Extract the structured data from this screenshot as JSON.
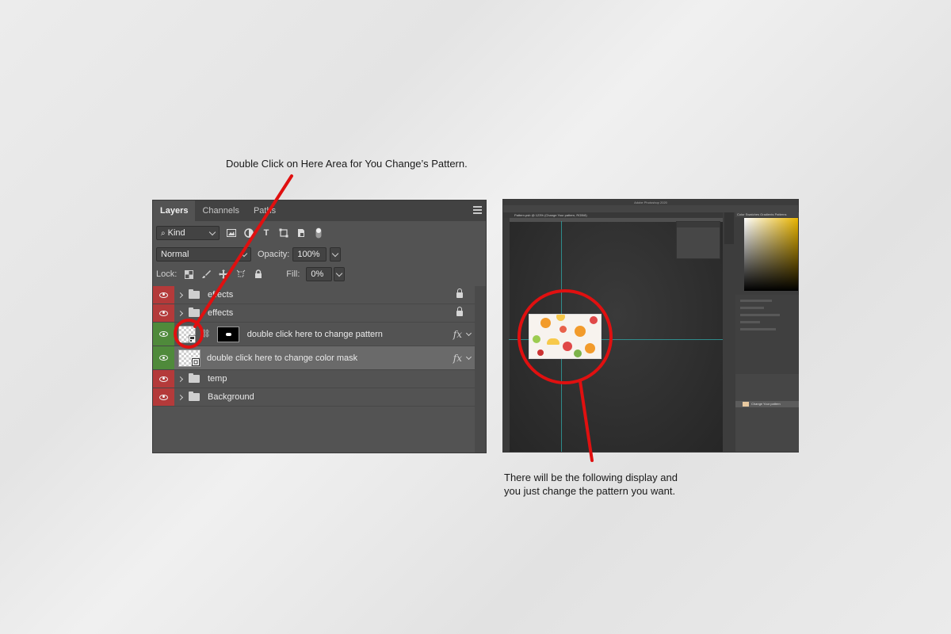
{
  "captions": {
    "top": "Double Click on Here Area for You Change’s Pattern.",
    "bottom_line1": "There will be the following display and",
    "bottom_line2": "you just change the pattern you want."
  },
  "layers_panel": {
    "tabs": [
      "Layers",
      "Channels",
      "Paths"
    ],
    "filter": {
      "label": "Kind"
    },
    "blend_mode": "Normal",
    "opacity_label": "Opacity:",
    "opacity_value": "100%",
    "lock_label": "Lock:",
    "fill_label": "Fill:",
    "fill_value": "0%",
    "layers": [
      {
        "name": "effects",
        "type": "group",
        "eye": "red",
        "locked": true
      },
      {
        "name": "effects",
        "type": "group",
        "eye": "red",
        "locked": true
      },
      {
        "name": "double click here to change pattern",
        "type": "pattern",
        "eye": "green",
        "fx": "fx"
      },
      {
        "name": "double click here to change color mask",
        "type": "color",
        "eye": "green",
        "fx": "fx",
        "selected": true
      },
      {
        "name": "temp",
        "type": "group",
        "eye": "red"
      },
      {
        "name": "Background",
        "type": "group",
        "eye": "red"
      }
    ]
  },
  "photoshop": {
    "window_title": "Adobe Photoshop 2020",
    "doc_tab": "Pattern.psb @ 123% (Change Your pattern, RGB/8)",
    "panel_tabs": "Color  Swatches  Gradients  Patterns",
    "layer_name": "Change Your pattern"
  },
  "colors": {
    "annotation": "#e01010",
    "eye_red": "#b43a3a",
    "eye_green": "#4f8a3b"
  }
}
